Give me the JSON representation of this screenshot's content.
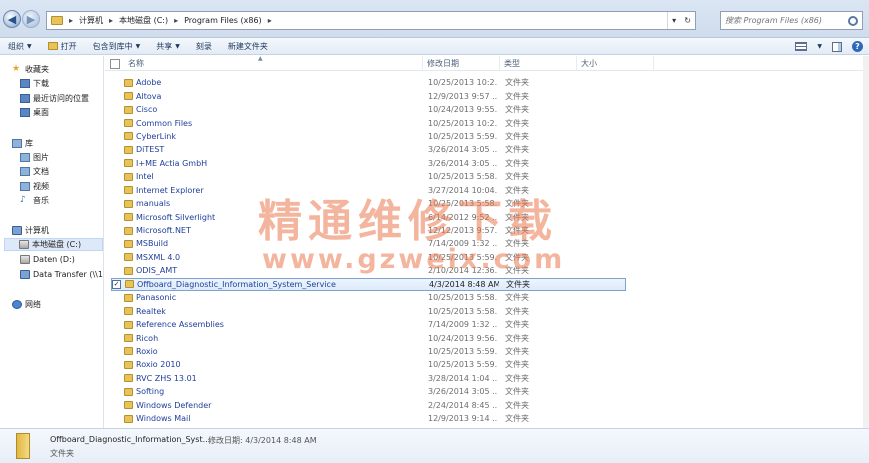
{
  "address": {
    "crumbs": [
      "计算机",
      "本地磁盘 (C:)",
      "Program Files (x86)"
    ],
    "search_placeholder": "搜索 Program Files (x86)"
  },
  "toolbar": {
    "organize": "组织",
    "open": "打开",
    "include_library": "包含到库中",
    "share": "共享",
    "burn": "刻录",
    "new_folder": "新建文件夹"
  },
  "nav": {
    "favorites": "收藏夹",
    "downloads": "下载",
    "recent": "最近访问的位置",
    "desktop": "桌面",
    "libraries": "库",
    "pictures": "图片",
    "documents": "文档",
    "videos": "视频",
    "music": "音乐",
    "computer": "计算机",
    "local_disk": "本地磁盘 (C:)",
    "daten": "Daten (D:)",
    "data_transfer": "Data Transfer (\\\\1",
    "network": "网络"
  },
  "columns": {
    "name": "名称",
    "date": "修改日期",
    "type": "类型",
    "size": "大小"
  },
  "rows": [
    {
      "name": "Adobe",
      "date": "10/25/2013 10:2...",
      "type": "文件夹"
    },
    {
      "name": "Altova",
      "date": "12/9/2013 9:57 ...",
      "type": "文件夹"
    },
    {
      "name": "Cisco",
      "date": "10/24/2013 9:55...",
      "type": "文件夹"
    },
    {
      "name": "Common Files",
      "date": "10/25/2013 10:2...",
      "type": "文件夹"
    },
    {
      "name": "CyberLink",
      "date": "10/25/2013 5:59...",
      "type": "文件夹"
    },
    {
      "name": "DiTEST",
      "date": "3/26/2014 3:05 ...",
      "type": "文件夹"
    },
    {
      "name": "I+ME Actia GmbH",
      "date": "3/26/2014 3:05 ...",
      "type": "文件夹"
    },
    {
      "name": "Intel",
      "date": "10/25/2013 5:58...",
      "type": "文件夹"
    },
    {
      "name": "Internet Explorer",
      "date": "3/27/2014 10:04...",
      "type": "文件夹"
    },
    {
      "name": "manuals",
      "date": "10/25/2013 5:58...",
      "type": "文件夹"
    },
    {
      "name": "Microsoft Silverlight",
      "date": "6/14/2012 9:52 ...",
      "type": "文件夹"
    },
    {
      "name": "Microsoft.NET",
      "date": "12/12/2013 9:57...",
      "type": "文件夹"
    },
    {
      "name": "MSBuild",
      "date": "7/14/2009 1:32 ...",
      "type": "文件夹"
    },
    {
      "name": "MSXML 4.0",
      "date": "10/25/2013 5:59...",
      "type": "文件夹"
    },
    {
      "name": "ODIS_AMT",
      "date": "2/10/2014 12:36...",
      "type": "文件夹"
    },
    {
      "name": "Offboard_Diagnostic_Information_System_Service",
      "date": "4/3/2014 8:48 AM",
      "type": "文件夹",
      "selected": true
    },
    {
      "name": "Panasonic",
      "date": "10/25/2013 5:58...",
      "type": "文件夹"
    },
    {
      "name": "Realtek",
      "date": "10/25/2013 5:58...",
      "type": "文件夹"
    },
    {
      "name": "Reference Assemblies",
      "date": "7/14/2009 1:32 ...",
      "type": "文件夹"
    },
    {
      "name": "Ricoh",
      "date": "10/24/2013 9:56...",
      "type": "文件夹"
    },
    {
      "name": "Roxio",
      "date": "10/25/2013 5:59...",
      "type": "文件夹"
    },
    {
      "name": "Roxio 2010",
      "date": "10/25/2013 5:59...",
      "type": "文件夹"
    },
    {
      "name": "RVC ZHS 13.01",
      "date": "3/28/2014 1:04 ...",
      "type": "文件夹"
    },
    {
      "name": "Softing",
      "date": "3/26/2014 3:05 ...",
      "type": "文件夹"
    },
    {
      "name": "Windows Defender",
      "date": "2/24/2014 8:45 ...",
      "type": "文件夹"
    },
    {
      "name": "Windows Mail",
      "date": "12/9/2013 9:14 ...",
      "type": "文件夹"
    }
  ],
  "watermark": {
    "cn": "精通维修下载",
    "url": "www.gzweix.com"
  },
  "details": {
    "name": "Offboard_Diagnostic_Information_Syst...",
    "modified": "修改日期: 4/3/2014 8:48 AM",
    "type": "文件夹"
  }
}
